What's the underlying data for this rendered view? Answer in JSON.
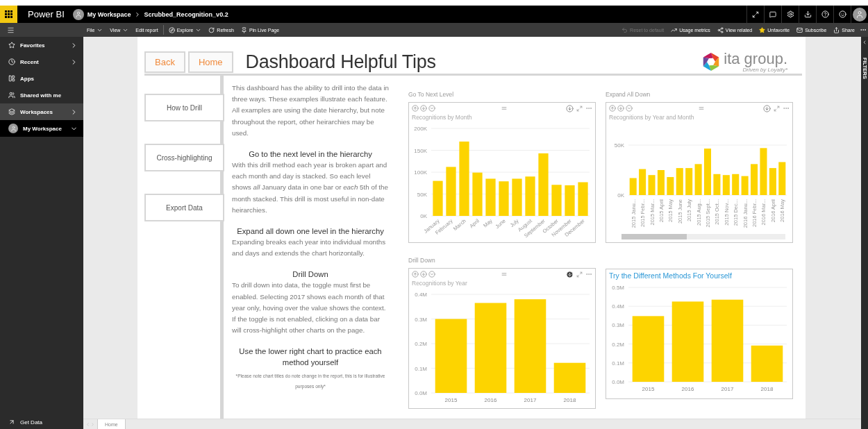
{
  "app": {
    "name": "Power BI"
  },
  "breadcrumb": [
    "My Workspace",
    "Scrubbed_Recognition_v0.2"
  ],
  "toolbar_left": [
    {
      "label": "File",
      "kind": "menu"
    },
    {
      "label": "View",
      "kind": "menu"
    },
    {
      "label": "Edit report",
      "kind": "plain"
    },
    {
      "label": "Explore",
      "kind": "explore"
    },
    {
      "label": "Refresh",
      "kind": "refresh"
    },
    {
      "label": "Pin Live Page",
      "kind": "pin"
    }
  ],
  "toolbar_right": [
    {
      "label": "Reset to default",
      "kind": "reset",
      "disabled": true
    },
    {
      "label": "Usage metrics",
      "kind": "metrics",
      "disabled": false
    },
    {
      "label": "View related",
      "kind": "related",
      "disabled": false
    },
    {
      "label": "Unfavorite",
      "kind": "star",
      "disabled": false
    },
    {
      "label": "Subscribe",
      "kind": "mail",
      "disabled": false
    },
    {
      "label": "Share",
      "kind": "share",
      "disabled": false
    }
  ],
  "sidebar": {
    "items": [
      {
        "label": "Favorites",
        "kind": "star",
        "expanded": false,
        "highlighted": false,
        "selected": false
      },
      {
        "label": "Recent",
        "kind": "clock",
        "expanded": false,
        "highlighted": false,
        "selected": false
      },
      {
        "label": "Apps",
        "kind": "apps",
        "highlighted": false,
        "selected": false
      },
      {
        "label": "Shared with me",
        "kind": "shared",
        "highlighted": false,
        "selected": false
      },
      {
        "label": "Workspaces",
        "kind": "workspaces",
        "expanded": false,
        "highlighted": true,
        "selected": false
      },
      {
        "label": "My Workspace",
        "kind": "avatar",
        "expanded": true,
        "highlighted": false,
        "selected": true
      }
    ],
    "footer": "Get Data"
  },
  "report": {
    "title": "Dashboard Helpful Tips",
    "nav_buttons": [
      "Back",
      "Home"
    ],
    "logo": {
      "name": "ita group.",
      "tagline": "Driven by Loyalty*"
    },
    "side_buttons": [
      "How to Drill",
      "Cross-highlighting",
      "Export Data"
    ],
    "tips": [
      {
        "kind": "paragraph",
        "text": "This dashboard has the ability to drill into the data in three ways. These examples illustrate each feature. All examples are using the date hierarchy, but note throughout the report, other heirarchies may be used."
      },
      {
        "kind": "heading",
        "text": "Go to the next level in the hierarchy"
      },
      {
        "kind": "paragraph",
        "text": "With this drill method each year is broken apart and each month and day is stacked. So each level shows *all* January data in one bar or *each* 5th of the month stacked. This drill is most useful in non-date heirarchies."
      },
      {
        "kind": "heading",
        "text": "Expand all down one level in the hierarchy"
      },
      {
        "kind": "paragraph",
        "text": "Expanding breaks each year into individual months and days and extends the chart horizontally."
      },
      {
        "kind": "heading",
        "text": "Drill Down"
      },
      {
        "kind": "paragraph",
        "text": "To drill down into data, the toggle must first be enabled. Selecting 2017 shows each month of that year only, hoving over the value shows the context. If the toggle is not enabled, clicking on a data bar will cross-highlight other charts on the page."
      },
      {
        "kind": "heading",
        "text": "Use the lower right chart to practice each method yourself"
      },
      {
        "kind": "note",
        "text": "*Please note chart titles do note change in the report, this is for illustrative purposes only*"
      }
    ],
    "charts": [
      {
        "kind": "visual",
        "caption": "Go To Next Level",
        "drill_mode": false,
        "scrollbar": false,
        "chart_data": {
          "type": "bar",
          "grid": true,
          "title": "Recognitions by Month",
          "categories": [
            "January",
            "February",
            "March",
            "April",
            "May",
            "June",
            "July",
            "August",
            "September",
            "October",
            "November",
            "December"
          ],
          "values": [
            80000,
            112000,
            170000,
            99000,
            85000,
            79000,
            85000,
            90000,
            143000,
            71000,
            70000,
            77000
          ],
          "ylim": [
            0,
            200000
          ],
          "yticks": [
            {
              "value": 0,
              "label": "0K"
            },
            {
              "value": 50000,
              "label": "50K"
            },
            {
              "value": 100000,
              "label": "100K"
            },
            {
              "value": 150000,
              "label": "150K"
            },
            {
              "value": 200000,
              "label": "200K"
            }
          ]
        }
      },
      {
        "kind": "visual",
        "caption": "Expand All Down",
        "drill_mode": false,
        "scrollbar": true,
        "chart_data": {
          "type": "bar",
          "grid": true,
          "title": "Recognitions by Year and Month",
          "categories": [
            "2015 Janu...",
            "2015 Febr...",
            "2015 Mar...",
            "2015 April",
            "2015 May",
            "2015 June",
            "2015 July",
            "2015 Aug...",
            "2015 Sept...",
            "2015 Oct...",
            "2015 Nov...",
            "2015 Dec...",
            "2016 Janu...",
            "2016 Febr...",
            "2016 Mar...",
            "2016 April",
            "2016 May"
          ],
          "values": [
            17000,
            26000,
            20000,
            25000,
            18000,
            27000,
            27000,
            31000,
            46500,
            21000,
            20000,
            21000,
            19000,
            31000,
            47000,
            27000,
            33000
          ],
          "ylim": [
            0,
            50000
          ],
          "yticks": [
            {
              "value": 0,
              "label": "0K"
            },
            {
              "value": 50000,
              "label": "50K"
            }
          ]
        }
      },
      {
        "kind": "visual",
        "caption": "Drill Down",
        "drill_mode": true,
        "scrollbar": false,
        "chart_data": {
          "type": "bar",
          "grid": true,
          "title": "Recognitions by Year",
          "categories": [
            "2015",
            "2016",
            "2017",
            "2018"
          ],
          "values": [
            300000,
            365000,
            380000,
            122000
          ],
          "ylim": [
            0,
            400000
          ],
          "yticks": [
            {
              "value": 0,
              "label": "0.0M"
            },
            {
              "value": 100000,
              "label": "0.1M"
            },
            {
              "value": 200000,
              "label": "0.2M"
            },
            {
              "value": 300000,
              "label": "0.3M"
            },
            {
              "value": 400000,
              "label": "0.4M"
            }
          ]
        }
      },
      {
        "kind": "plain",
        "chart_data": {
          "type": "bar",
          "grid": true,
          "title": "Try the Different Methods For Yourself",
          "categories": [
            "2015",
            "2016",
            "2017",
            "2018"
          ],
          "values": [
            348000,
            425000,
            435000,
            192000
          ],
          "ylim": [
            0,
            500000
          ],
          "yticks": [
            {
              "value": 0,
              "label": "0.0M"
            },
            {
              "value": 100000,
              "label": "0.1M"
            },
            {
              "value": 200000,
              "label": "0.2M"
            },
            {
              "value": 300000,
              "label": "0.3M"
            },
            {
              "value": 400000,
              "label": "0.4M"
            },
            {
              "value": 500000,
              "label": "0.5M"
            }
          ]
        }
      }
    ]
  },
  "page_tabs": [
    {
      "label": "Home",
      "selected": true
    }
  ],
  "filters_pane": {
    "label": "FILTERS"
  }
}
